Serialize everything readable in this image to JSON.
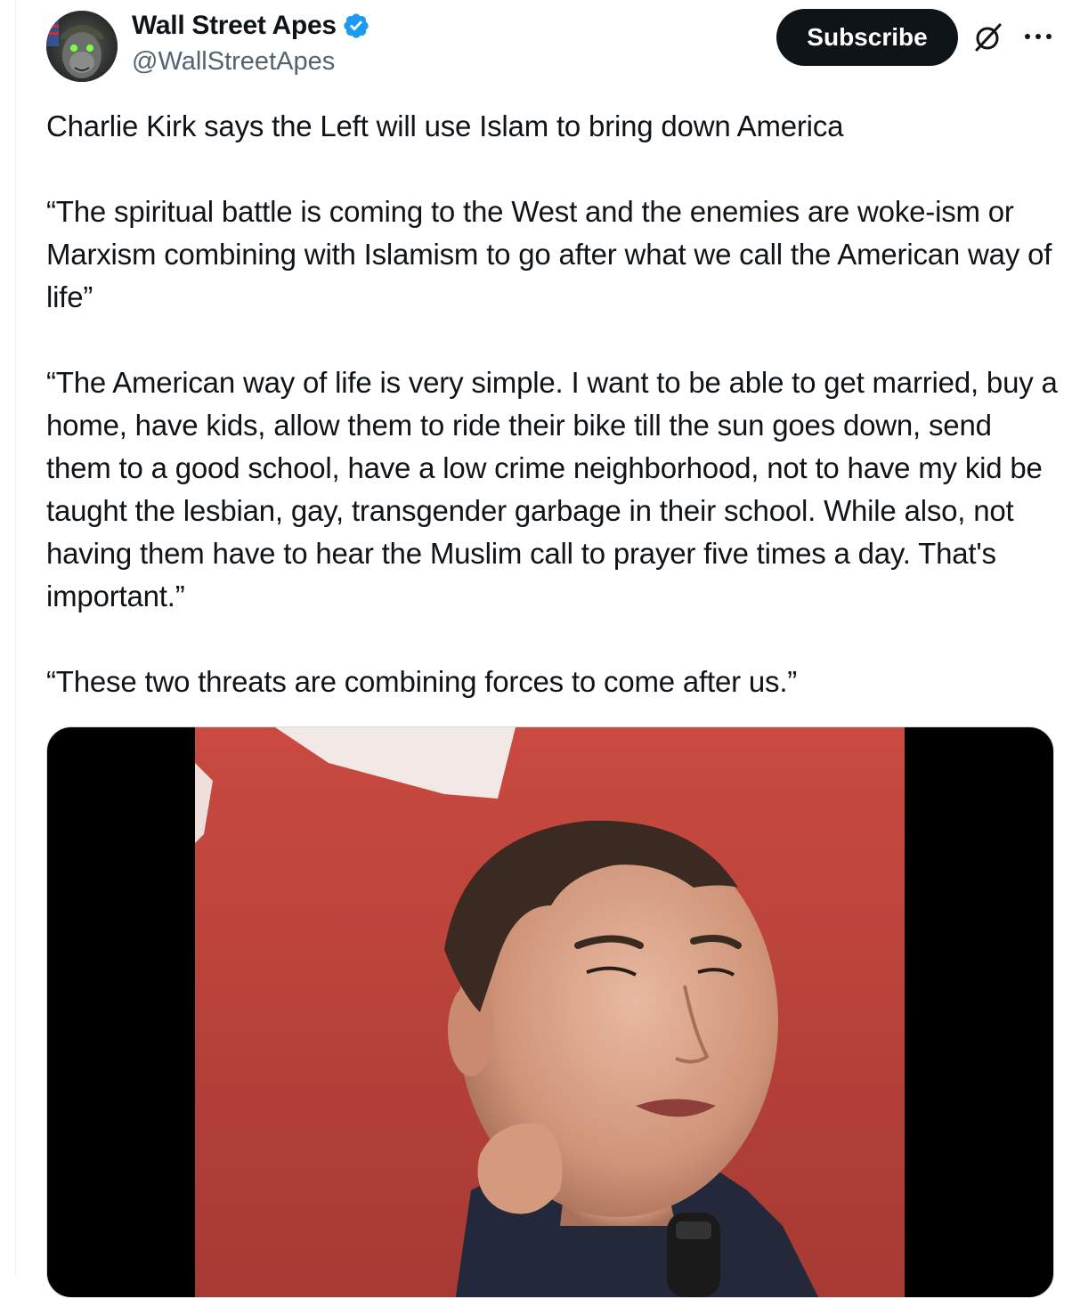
{
  "author": {
    "display_name": "Wall Street Apes",
    "handle": "@WallStreetApes",
    "verified": true
  },
  "actions": {
    "subscribe_label": "Subscribe"
  },
  "icons": {
    "avatar": "ape-avatar",
    "verified": "verified-badge-icon",
    "grok": "grok-icon",
    "more": "more-options-icon"
  },
  "tweet": {
    "paragraphs": [
      "Charlie Kirk says the Left will use Islam to bring down America",
      "“The spiritual battle is coming to the West and the enemies are woke-ism or Marxism combining with Islamism to go after what we call the American way of life”",
      "“The American way of life is very simple. I want to be able to get married, buy a home, have kids, allow them to ride their bike till the sun goes down, send them to a good school, have a low crime neighborhood, not to have my kid be taught the lesbian, gay, transgender garbage in their school. While also, not having them have to hear the Muslim call to prayer five times a day. That's important.”",
      "“These two threats are combining forces to come after us.”"
    ]
  },
  "colors": {
    "text_primary": "#0f1419",
    "text_secondary": "#536471",
    "verified_blue": "#1d9bf0",
    "button_bg": "#0f1419",
    "button_text": "#ffffff",
    "video_background": "#c4453c"
  }
}
